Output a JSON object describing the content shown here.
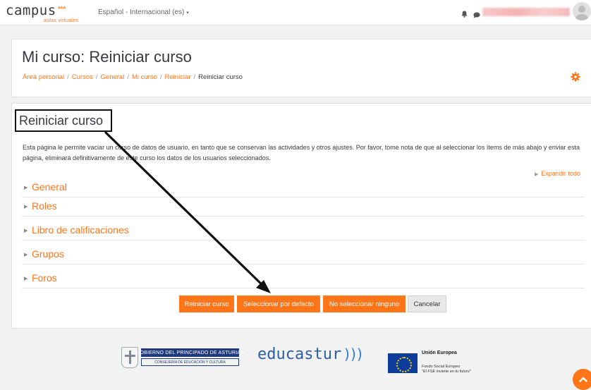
{
  "navbar": {
    "logo_text": "campus",
    "logo_stars": "***",
    "logo_subtitle": "aulas virtuales",
    "language": "Español - Internacional (es)",
    "language_caret": "▾"
  },
  "header": {
    "page_title": "Mi curso: Reiniciar curso",
    "breadcrumb": [
      "Área personal",
      "Cursos",
      "General",
      "Mi curso",
      "Reiniciar",
      "Reiniciar curso"
    ]
  },
  "main": {
    "section_title": "Reiniciar curso",
    "description": "Esta página le permite vaciar un curso de datos de usuario, en tanto que se conservan las actividades y otros ajustes. Por favor, tome nota de que al seleccionar los ítems de más abajo y enviar esta página, eliminará definitivamente de este curso los datos de los usuarios seleccionados.",
    "expand_all": "Expandir todo",
    "sections": [
      "General",
      "Roles",
      "Libro de calificaciones",
      "Grupos",
      "Foros"
    ],
    "buttons": {
      "reset": "Reiniciar curso",
      "select_default": "Seleccionar por defecto",
      "select_none": "No seleccionar ninguno",
      "cancel": "Cancelar"
    }
  },
  "footer": {
    "asturias_title": "GOBIERNO DEL PRINCIPADO DE ASTURIAS",
    "asturias_dept": "CONSEJERÍA DE EDUCACIÓN Y CULTURA",
    "educastur": "educastur",
    "educastur_waves": ")))",
    "eu_title": "Unión Europea",
    "eu_line1": "Fondo Social Europeo",
    "eu_line2": "\"El FSE invierte en tu futuro\""
  },
  "colors": {
    "accent": "#ff7518",
    "text": "#373a3c",
    "background": "#f2f2f2",
    "annotation": "#111111"
  },
  "icons": [
    "bell-icon",
    "chat-icon",
    "gear-icon",
    "chevron-up-icon",
    "caret-right-icon"
  ]
}
